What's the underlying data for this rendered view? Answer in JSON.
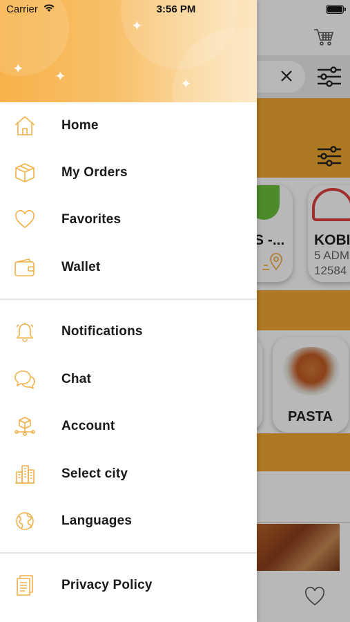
{
  "status_bar": {
    "carrier": "Carrier",
    "time": "3:56 PM"
  },
  "colors": {
    "accent": "#f0a830",
    "icon_stroke": "#f2b04a",
    "header_gradient_start": "#f7b24a",
    "header_gradient_end": "#fde6c0"
  },
  "drawer": {
    "menu_primary": [
      {
        "label": "Home",
        "icon": "home-icon"
      },
      {
        "label": "My Orders",
        "icon": "box-icon"
      },
      {
        "label": "Favorites",
        "icon": "heart-icon"
      },
      {
        "label": "Wallet",
        "icon": "wallet-icon"
      }
    ],
    "menu_secondary": [
      {
        "label": "Notifications",
        "icon": "bell-icon"
      },
      {
        "label": "Chat",
        "icon": "chat-icon"
      },
      {
        "label": "Account",
        "icon": "account-icon"
      },
      {
        "label": "Select city",
        "icon": "city-icon"
      },
      {
        "label": "Languages",
        "icon": "globe-icon"
      }
    ],
    "menu_footer": [
      {
        "label": "Privacy Policy",
        "icon": "document-icon"
      }
    ]
  },
  "background": {
    "cards": [
      {
        "title": "S -...",
        "icon": "location-pin-icon"
      },
      {
        "title": "KOBI",
        "line1": "5 ADM",
        "line2": "12584"
      }
    ],
    "category": {
      "title": "PASTA"
    }
  }
}
